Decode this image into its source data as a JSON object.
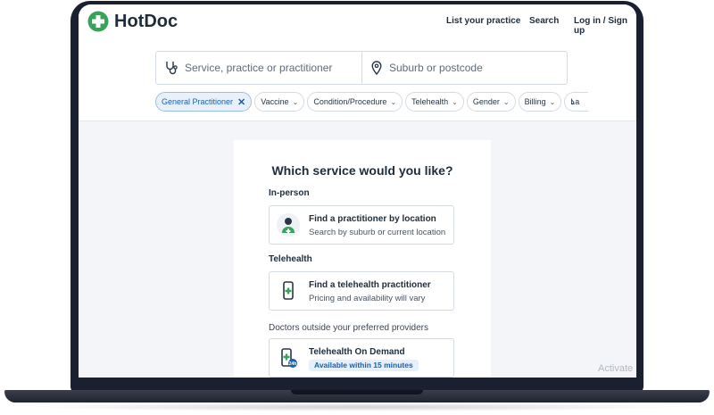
{
  "brand": {
    "name": "HotDoc",
    "color": "#36a25a"
  },
  "nav": {
    "list_practice": "List your practice",
    "search": "Search",
    "login": "Log in / Sign up"
  },
  "search": {
    "service_placeholder": "Service, practice or practitioner",
    "location_placeholder": "Suburb or postcode"
  },
  "filters": [
    {
      "label": "General Practitioner",
      "active": true
    },
    {
      "label": "Vaccine"
    },
    {
      "label": "Condition/Procedure"
    },
    {
      "label": "Telehealth"
    },
    {
      "label": "Gender"
    },
    {
      "label": "Billing"
    },
    {
      "label": "La"
    }
  ],
  "card": {
    "title": "Which service would you like?",
    "in_person": {
      "heading": "In-person",
      "option_title": "Find a practitioner by location",
      "option_subtitle": "Search by suburb or current location"
    },
    "telehealth": {
      "heading": "Telehealth",
      "option_title": "Find a telehealth practitioner",
      "option_subtitle": "Pricing and availability will vary"
    },
    "outside": {
      "heading": "Doctors outside your preferred providers",
      "option_title": "Telehealth On Demand",
      "badge": "Available within 15 minutes",
      "icon_text": "24h"
    }
  },
  "watermark": "Activate"
}
